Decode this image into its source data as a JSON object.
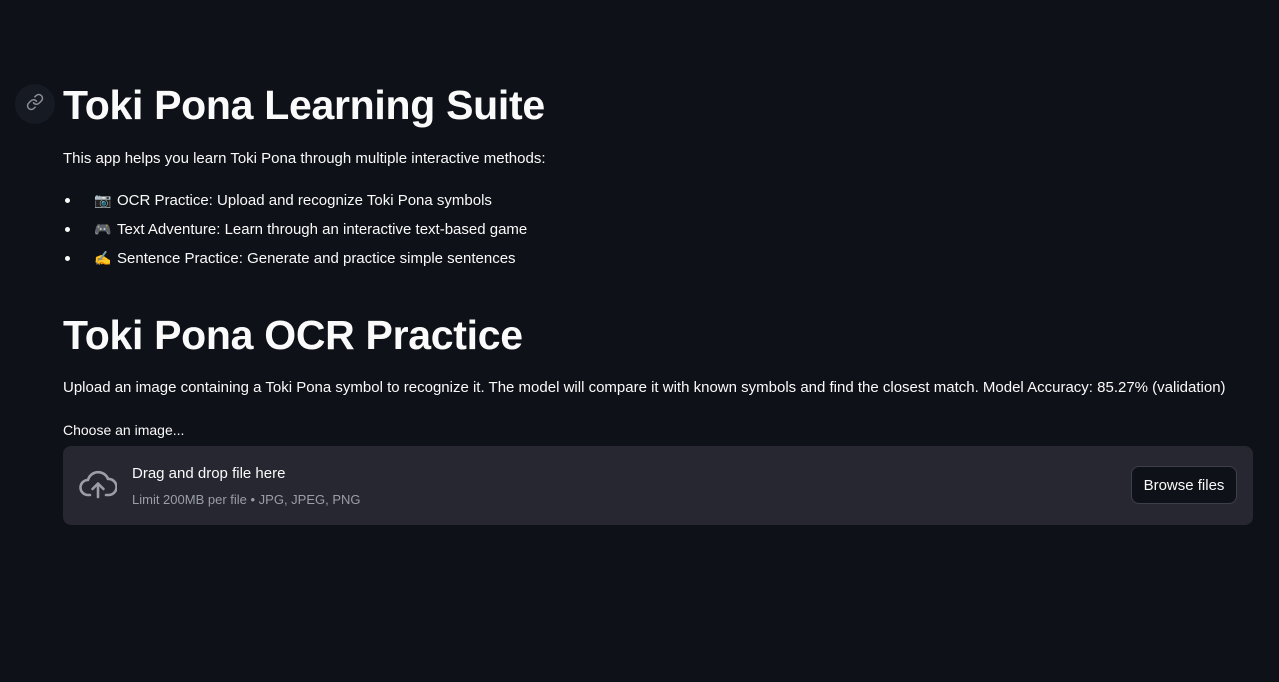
{
  "header": {
    "title": "Toki Pona Learning Suite",
    "anchor_icon": "link-icon"
  },
  "intro": {
    "text": "This app helps you learn Toki Pona through multiple interactive methods:",
    "features": [
      {
        "icon": "camera-emoji",
        "emoji": "📷",
        "text": "OCR Practice: Upload and recognize Toki Pona symbols"
      },
      {
        "icon": "game-controller-emoji",
        "emoji": "🎮",
        "text": "Text Adventure: Learn through an interactive text-based game"
      },
      {
        "icon": "writing-hand-emoji",
        "emoji": "✍️",
        "text": "Sentence Practice: Generate and practice simple sentences"
      }
    ]
  },
  "ocr": {
    "title": "Toki Pona OCR Practice",
    "description": "Upload an image containing a Toki Pona symbol to recognize it. The model will compare it with known symbols and find the closest match. Model Accuracy: 85.27% (validation)",
    "uploader": {
      "label": "Choose an image...",
      "drop_text": "Drag and drop file here",
      "limit_text": "Limit 200MB per file • JPG, JPEG, PNG",
      "browse_label": "Browse files",
      "icon": "cloud-upload-icon"
    }
  },
  "colors": {
    "background": "#0e1117",
    "text": "#fafafa",
    "dropzone": "#262730",
    "muted": "#9b9ea6"
  }
}
